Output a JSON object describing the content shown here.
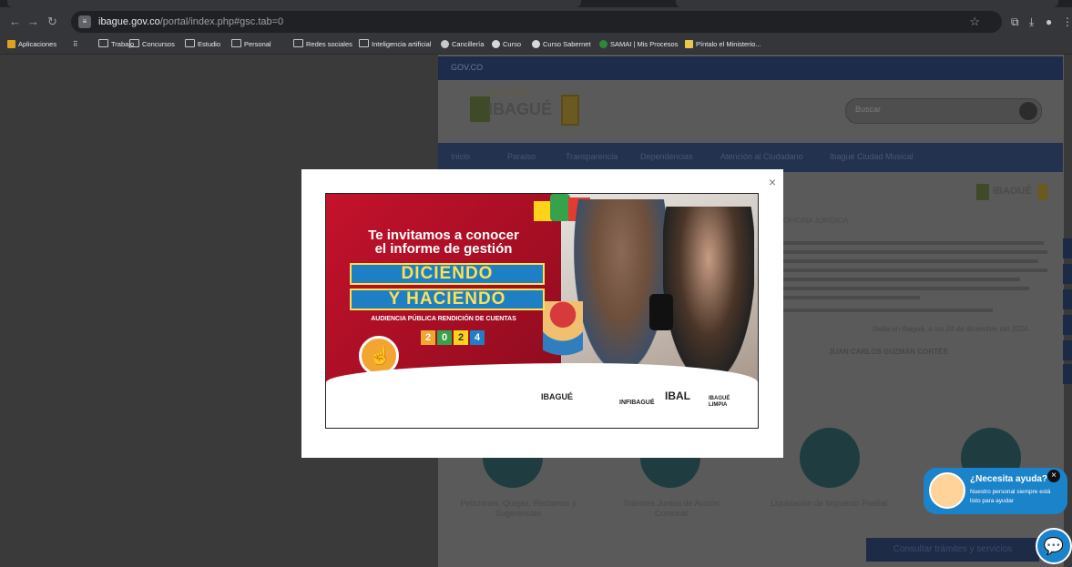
{
  "browser": {
    "url_domain": "ibague.gov.co",
    "url_path": "/portal/index.php#gsc.tab=0",
    "bookmarks": [
      "Aplicaciones",
      "Trabajo",
      "Concursos",
      "Estudio",
      "Personal",
      "Redes sociales",
      "Inteligencia artificial",
      "Cancillería",
      "Curso",
      "Curso Sabernet",
      "SAMAI | Mis Procesos",
      "Píntalo el Ministerio..."
    ]
  },
  "site": {
    "gov_label": "GOV.CO",
    "logo_top": "ALCALDÍA DE",
    "logo_name": "IBAGUÉ",
    "search_placeholder": "Buscar",
    "nav": [
      "Inicio",
      "Paraíso",
      "Transparencia",
      "Dependencias",
      "Atención al Ciudadano",
      "Ibagué Ciudad Musical"
    ],
    "section_label": "OFICINA JURÍDICA",
    "date_text": "Dada en Ibagué, a los 24 de diciembre del 2024.",
    "signature": "JUAN CARLOS GUZMÁN CORTÉS",
    "services": [
      "Peticiones, Quejas, Reclamos y Sugerencias",
      "Trámites Juntas de Acción Comunal",
      "Liquidación de Impuesto Predial"
    ],
    "consult_button": "Consultar trámites y servicios"
  },
  "modal": {
    "close": "×",
    "banner": {
      "headline_1": "Te invitamos a conocer",
      "headline_2": "el informe de gestión",
      "big_1": "DICIENDO",
      "big_2": "Y HACIENDO",
      "subtitle": "AUDIENCIA PÚBLICA RENDICIÓN DE CUENTAS",
      "year_digits": [
        "2",
        "0",
        "2",
        "4"
      ],
      "logos": [
        "IBAGUÉ",
        "INFIBAGUÉ",
        "IBAL",
        "IBAGUÉ LIMPIA"
      ]
    }
  },
  "chat": {
    "title": "¿Necesita ayuda?",
    "subtitle": "Nuestro personal siempre está listo para ayudar"
  }
}
